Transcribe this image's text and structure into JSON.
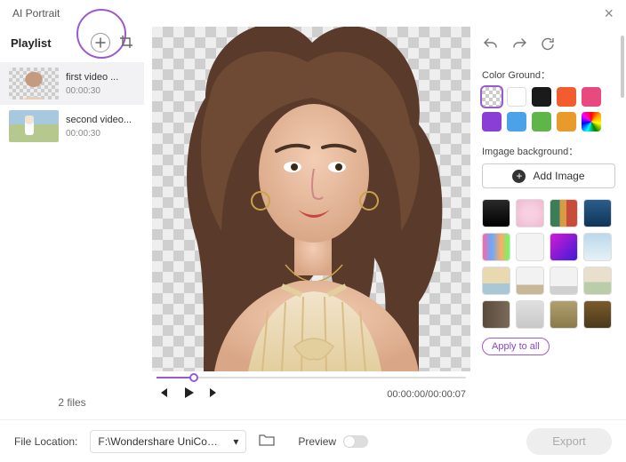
{
  "app": {
    "title": "AI Portrait",
    "close": "×"
  },
  "sidebar": {
    "playlist_label": "Playlist",
    "items": [
      {
        "title": "first video ...",
        "time": "00:00:30"
      },
      {
        "title": "second video...",
        "time": "00:00:30"
      }
    ],
    "file_count": "2 files"
  },
  "playback": {
    "time": "00:00:00/00:00:07"
  },
  "right": {
    "color_ground_label": "Color Ground：",
    "image_bg_label": "Imgage background：",
    "add_image_label": "Add Image",
    "apply_all_label": "Apply to all",
    "swatches": [
      {
        "name": "transparent",
        "css": "swatch-transparent",
        "selected": true
      },
      {
        "name": "white",
        "style": "background:#ffffff;border:1px solid #ddd"
      },
      {
        "name": "black",
        "style": "background:#1a1a1a"
      },
      {
        "name": "orange",
        "style": "background:#f25c2e"
      },
      {
        "name": "pink",
        "style": "background:#e8497e"
      },
      {
        "name": "purple",
        "style": "background:#8a3ed6"
      },
      {
        "name": "sky",
        "style": "background:#4aa3e8"
      },
      {
        "name": "green",
        "style": "background:#5fb54a"
      },
      {
        "name": "amber",
        "style": "background:#e89b2a"
      },
      {
        "name": "rainbow",
        "css": "swatch-rainbow"
      }
    ],
    "bg_thumbs": [
      {
        "name": "bg-dark",
        "style": "background:linear-gradient(#2a2a2a,#000)"
      },
      {
        "name": "bg-blossom",
        "style": "background:radial-gradient(circle,#f7d0e0 30%,#eeb8d0)"
      },
      {
        "name": "bg-painting",
        "style": "background:linear-gradient(90deg,#3a7d57 35%,#d89a44 35% 60%,#c94b3a 60%)"
      },
      {
        "name": "bg-ocean",
        "style": "background:linear-gradient(#2a5e8a,#0e3557)"
      },
      {
        "name": "bg-grad1",
        "style": "background:linear-gradient(90deg,#f6a,#6af,#fa6,#6f6)"
      },
      {
        "name": "bg-plain",
        "style": "background:#f3f3f3"
      },
      {
        "name": "bg-neon",
        "style": "background:linear-gradient(135deg,#d41bd6,#3d1bd6)"
      },
      {
        "name": "bg-ice",
        "style": "background:linear-gradient(#bcd8ea,#e5f1f8)"
      },
      {
        "name": "bg-beach",
        "style": "background:linear-gradient(#e8d9b0 60%,#a8c8d8 60%)"
      },
      {
        "name": "bg-room1",
        "style": "background:linear-gradient(#f2f2f2 65%,#c8b898 65%)"
      },
      {
        "name": "bg-room2",
        "style": "background:linear-gradient(#f2f2f2 70%,#d0d0d0 70%)"
      },
      {
        "name": "bg-office",
        "style": "background:linear-gradient(#e8e0cc 55%,#bca 55%)"
      },
      {
        "name": "bg-booth",
        "style": "background:linear-gradient(90deg,#5a4a3a,#7a6a5a)"
      },
      {
        "name": "bg-studio",
        "style": "background:linear-gradient(#e0e0e0,#c8c8c8)"
      },
      {
        "name": "bg-hall",
        "style": "background:linear-gradient(#b0a070,#8a7a4a)"
      },
      {
        "name": "bg-stage",
        "style": "background:linear-gradient(#7a5a2a,#4a3a1a)"
      }
    ]
  },
  "footer": {
    "location_label": "File Location:",
    "location_value": "F:\\Wondershare UniConverte...",
    "preview_label": "Preview",
    "export_label": "Export"
  }
}
